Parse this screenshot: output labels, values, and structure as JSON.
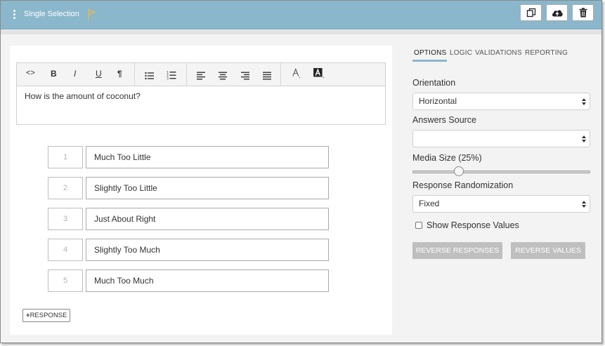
{
  "header": {
    "title": "Single Selection",
    "accent_color": "#8ab7cc",
    "flag_color": "#e0b85a",
    "buttons": [
      {
        "name": "copy-icon"
      },
      {
        "name": "cloud-upload-icon"
      },
      {
        "name": "trash-icon"
      }
    ]
  },
  "editor": {
    "toolbar": {
      "source": "<>",
      "bold": "B",
      "italic": "I",
      "underline": "U",
      "paragraph": "¶"
    },
    "question": "How is the amount of coconut?"
  },
  "responses": [
    {
      "num": "1",
      "text": "Much Too Little"
    },
    {
      "num": "2",
      "text": "Slightly Too Little"
    },
    {
      "num": "3",
      "text": "Just About Right"
    },
    {
      "num": "4",
      "text": "Slightly Too Much"
    },
    {
      "num": "5",
      "text": "Much Too Much"
    }
  ],
  "add_response_label": "RESPONSE",
  "sidebar": {
    "tabs": [
      {
        "label": "OPTIONS",
        "active": true
      },
      {
        "label": "LOGIC",
        "active": false
      },
      {
        "label": "VALIDATIONS",
        "active": false
      },
      {
        "label": "REPORTING",
        "active": false
      }
    ],
    "orientation_label": "Orientation",
    "orientation_value": "Horizontal",
    "answers_source_label": "Answers Source",
    "answers_source_value": "",
    "media_size_label": "Media Size (25%)",
    "media_size_fraction": 0.25,
    "randomization_label": "Response Randomization",
    "randomization_value": "Fixed",
    "show_values_label": "Show Response Values",
    "show_values_checked": false,
    "reverse_responses_label": "REVERSE RESPONSES",
    "reverse_values_label": "REVERSE VALUES"
  }
}
